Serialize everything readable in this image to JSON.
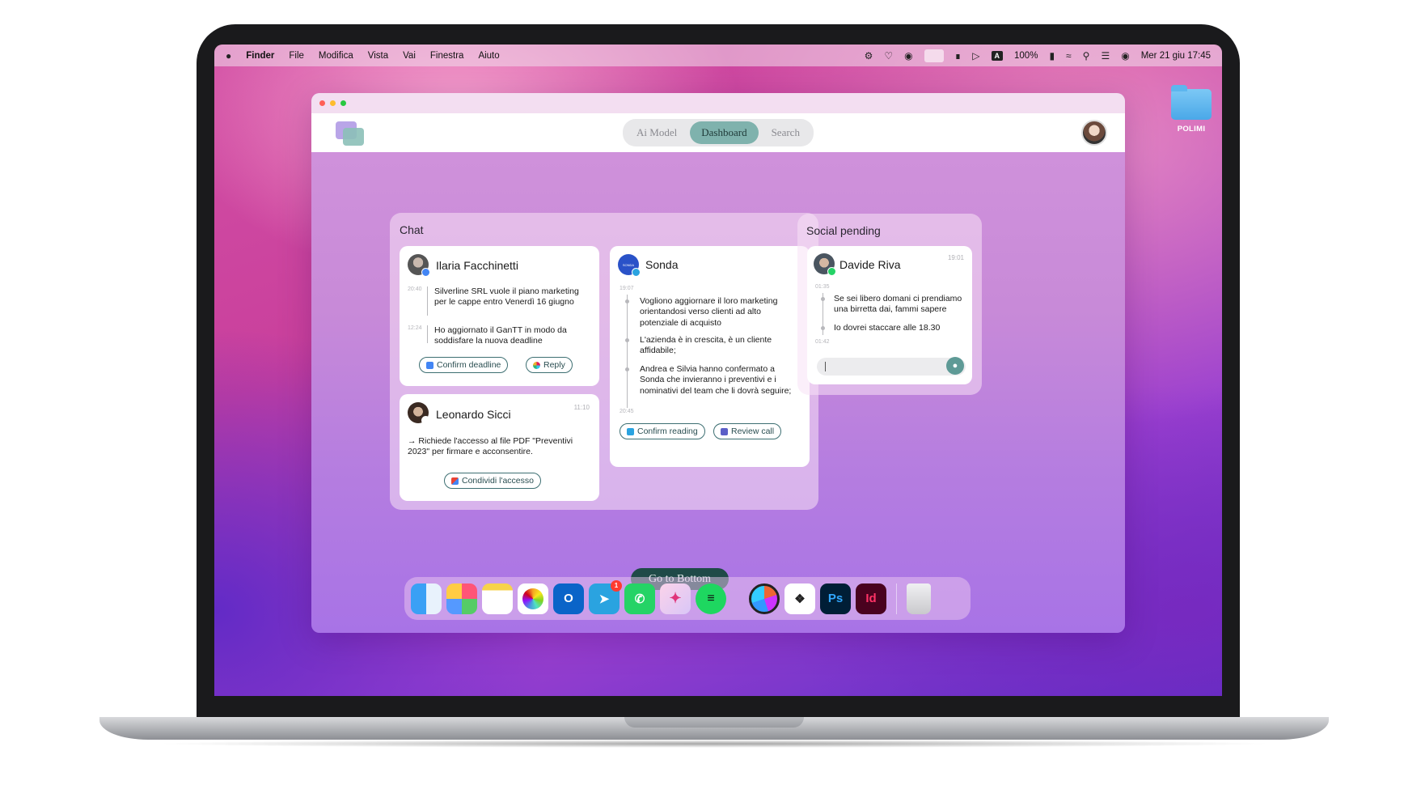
{
  "menubar": {
    "apple": "",
    "app_name": "Finder",
    "menus": [
      "File",
      "Modifica",
      "Vista",
      "Vai",
      "Finestra",
      "Aiuto"
    ],
    "battery": "100%",
    "datetime": "Mer 21 giu  17:45",
    "input_indicator": "A"
  },
  "desktop": {
    "folder_label": "POLIMI"
  },
  "app": {
    "tabs": [
      "Ai Model",
      "Dashboard",
      "Search"
    ],
    "active_tab": "Dashboard"
  },
  "chat": {
    "title": "Chat",
    "ilaria": {
      "name": "Ilaria Facchinetti",
      "ts1": "20:40",
      "msg1": "Silverline SRL vuole il piano marketing per le cappe entro Venerdì 16 giugno",
      "ts2": "12:24",
      "msg2": "Ho aggiornato il GanTT in modo da soddisfare la nuova deadline",
      "btn_confirm": "Confirm deadline",
      "btn_reply": "Reply"
    },
    "leonardo": {
      "name": "Leonardo Sicci",
      "time": "11:10",
      "msg": "→ Richiede l'accesso al file PDF \"Preventivi 2023\" per firmare e acconsentire.",
      "btn": "Condividi l'accesso"
    },
    "sonda": {
      "name": "Sonda",
      "avatar_text": "SONDA",
      "ts_start": "19:07",
      "msg1": "Vogliono aggiornare il loro marketing orientandosi verso clienti ad alto potenziale di acquisto",
      "msg2": "L'azienda è in crescita, è un cliente affidabile;",
      "msg3": "Andrea e Silvia hanno confermato a Sonda che invieranno i preventivi e i nominativi del team che li dovrà seguire;",
      "ts_end": "20:45",
      "btn_confirm": "Confirm reading",
      "btn_review": "Review call"
    }
  },
  "social": {
    "title": "Social pending",
    "davide": {
      "name": "Davide Riva",
      "time": "19:01",
      "ts1": "01:35",
      "msg1": "Se sei libero domani ci prendiamo una birretta dai, fammi sapere",
      "msg2": "Io dovrei staccare alle 18.30",
      "ts2": "01:42"
    }
  },
  "go_bottom": "Go to Bottom",
  "dock": {
    "apps": [
      "finder",
      "launchpad",
      "notes",
      "photos",
      "outlook",
      "telegram",
      "whatsapp",
      "craft",
      "spotify",
      "arc",
      "figma",
      "photoshop",
      "indesign",
      "trash"
    ],
    "telegram_badge": "1",
    "ps_label": "Ps",
    "id_label": "Id"
  },
  "colors": {
    "accent": "#7fb2ad",
    "button_dark": "#1f4a48",
    "brand_purple": "#b9a5e8"
  }
}
